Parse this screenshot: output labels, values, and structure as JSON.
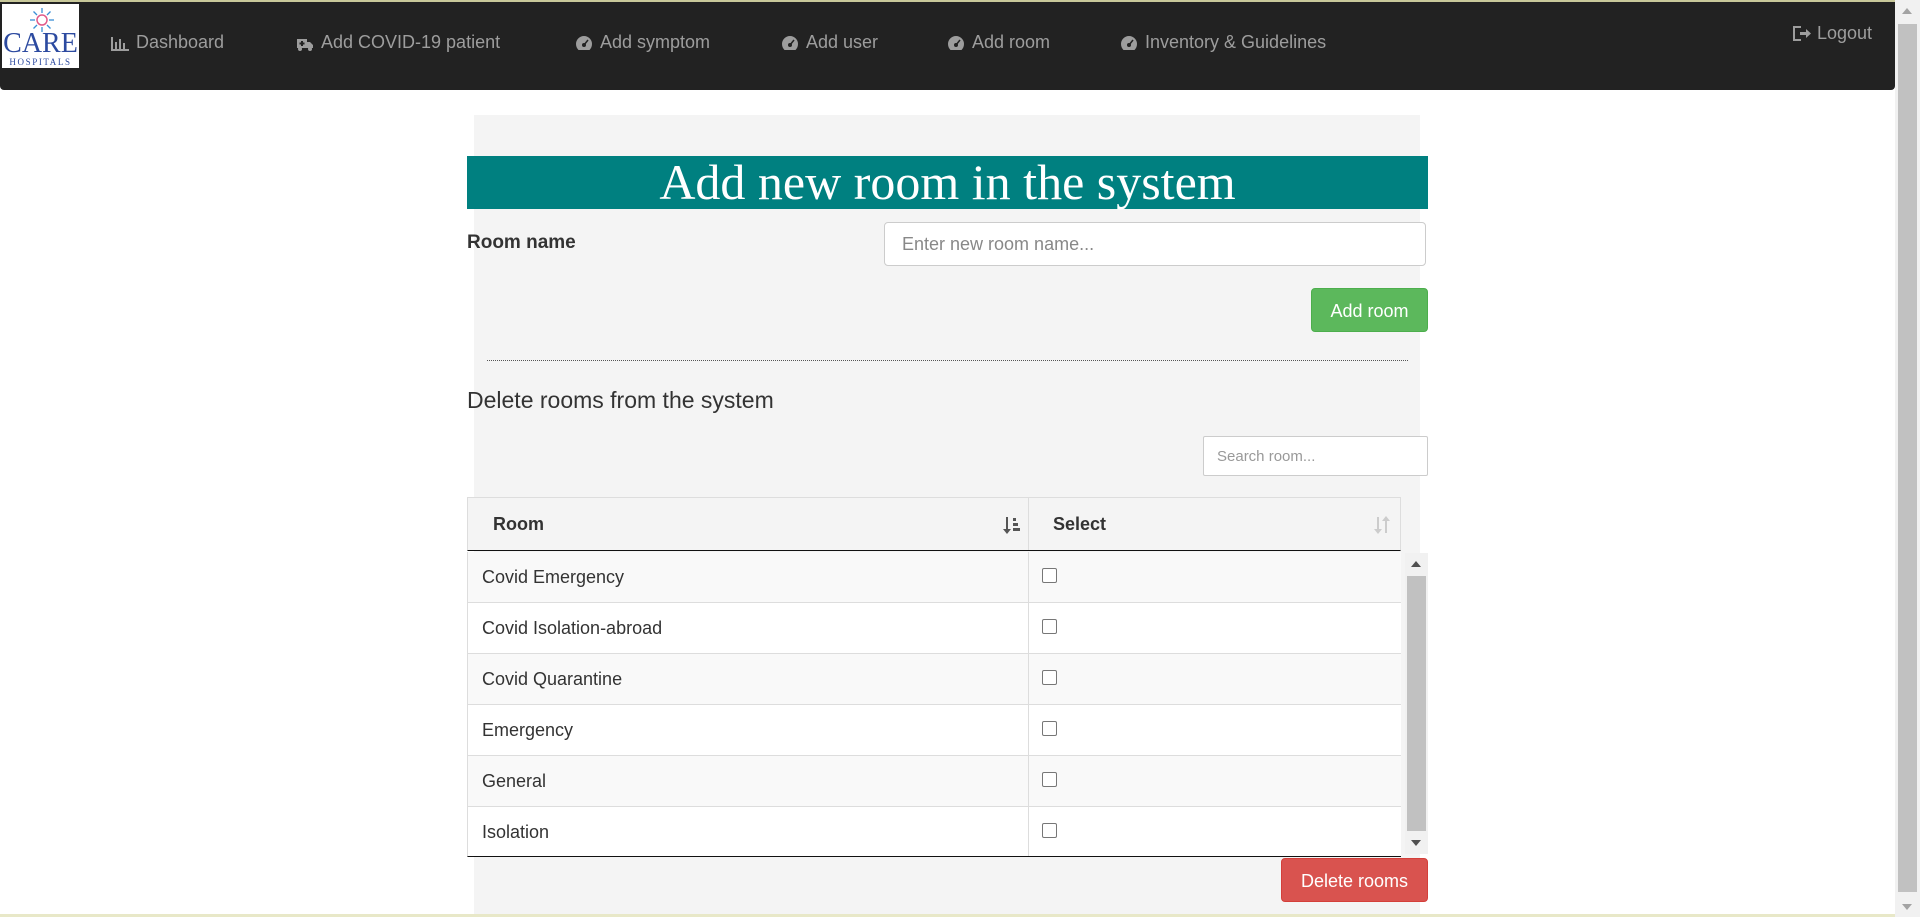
{
  "brand": {
    "name": "CARE",
    "sub": "HOSPITALS"
  },
  "nav": {
    "items": [
      {
        "label": "Dashboard",
        "icon": "bar-chart-icon"
      },
      {
        "label": "Add COVID-19 patient",
        "icon": "ambulance-icon"
      },
      {
        "label": "Add symptom",
        "icon": "dashboard-gauge-icon"
      },
      {
        "label": "Add user",
        "icon": "dashboard-gauge-icon"
      },
      {
        "label": "Add room",
        "icon": "dashboard-gauge-icon"
      },
      {
        "label": "Inventory & Guidelines",
        "icon": "dashboard-gauge-icon"
      }
    ],
    "logout": "Logout"
  },
  "form": {
    "heading": "Add new room in the system",
    "room_label": "Room name",
    "room_placeholder": "Enter new room name...",
    "add_button": "Add room"
  },
  "delete": {
    "heading": "Delete rooms from the system",
    "search_placeholder": "Search room...",
    "columns": [
      "Room",
      "Select"
    ],
    "rows": [
      {
        "room": "Covid Emergency",
        "checked": false
      },
      {
        "room": "Covid Isolation-abroad",
        "checked": false
      },
      {
        "room": "Covid Quarantine",
        "checked": false
      },
      {
        "room": "Emergency",
        "checked": false
      },
      {
        "room": "General",
        "checked": false
      },
      {
        "room": "Isolation",
        "checked": false
      }
    ],
    "delete_button": "Delete rooms"
  },
  "colors": {
    "navbar": "#222222",
    "banner": "#008080",
    "add_button": "#5cb85c",
    "delete_button": "#d9534f",
    "panel": "#f4f4f4"
  }
}
